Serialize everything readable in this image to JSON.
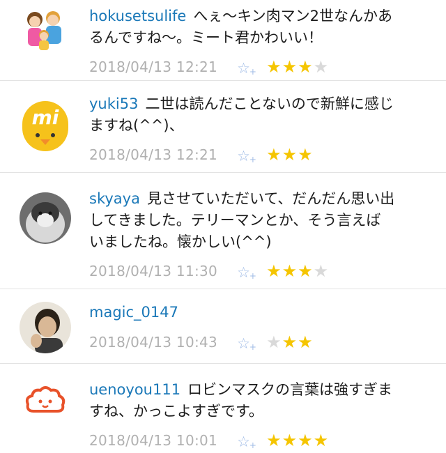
{
  "comments": [
    {
      "username": "hokusetsulife",
      "text": "へぇ〜キン肉マン2世なんかあるんですね〜。ミート君かわいい！",
      "lines": [
        "へぇ〜キン肉マン2世なんかあ",
        "るんですね〜。ミート君かわいい！"
      ],
      "timestamp": "2018/04/13 12:21",
      "stars_filled": 3,
      "stars_total": 4
    },
    {
      "username": "yuki53",
      "text": "二世は読んだことないので新鮮に感じますね(^^)、",
      "lines": [
        "二世は読んだことないので新鮮に感じ",
        "ますね(^^)、"
      ],
      "timestamp": "2018/04/13 12:21",
      "stars_filled": 3,
      "stars_total": 3
    },
    {
      "username": "skyaya",
      "text": "見させていただいて、だんだん思い出してきました。テリーマンとか、そう言えばいましたね。懐かしい(^^)",
      "lines": [
        "見させていただいて、だんだん思い出",
        "してきました。テリーマンとか、そう言えば",
        "いましたね。懐かしい(^^)"
      ],
      "timestamp": "2018/04/13 11:30",
      "stars_filled": 3,
      "stars_total": 4
    },
    {
      "username": "magic_0147",
      "text": "",
      "lines": [],
      "timestamp": "2018/04/13 10:43",
      "stars_filled": 2,
      "stars_total": 3
    },
    {
      "username": "uenoyou111",
      "text": "ロビンマスクの言葉は強すぎますね、かっこよすぎです。",
      "lines": [
        "ロビンマスクの言葉は強すぎま",
        "すね、かっこよすぎです。"
      ],
      "timestamp": "2018/04/13 10:01",
      "stars_filled": 4,
      "stars_total": 4
    }
  ],
  "icons": {
    "favorite_add": "star-plus-icon",
    "rating": "star-icon"
  },
  "avatar_logo_text": "mi",
  "colors": {
    "username": "#1a78b8",
    "timestamp": "#b0b0b0",
    "star_on": "#f5c500",
    "star_off": "#d9d9d9",
    "fav_icon": "#9fbbe6",
    "divider": "#e3e3e3"
  }
}
